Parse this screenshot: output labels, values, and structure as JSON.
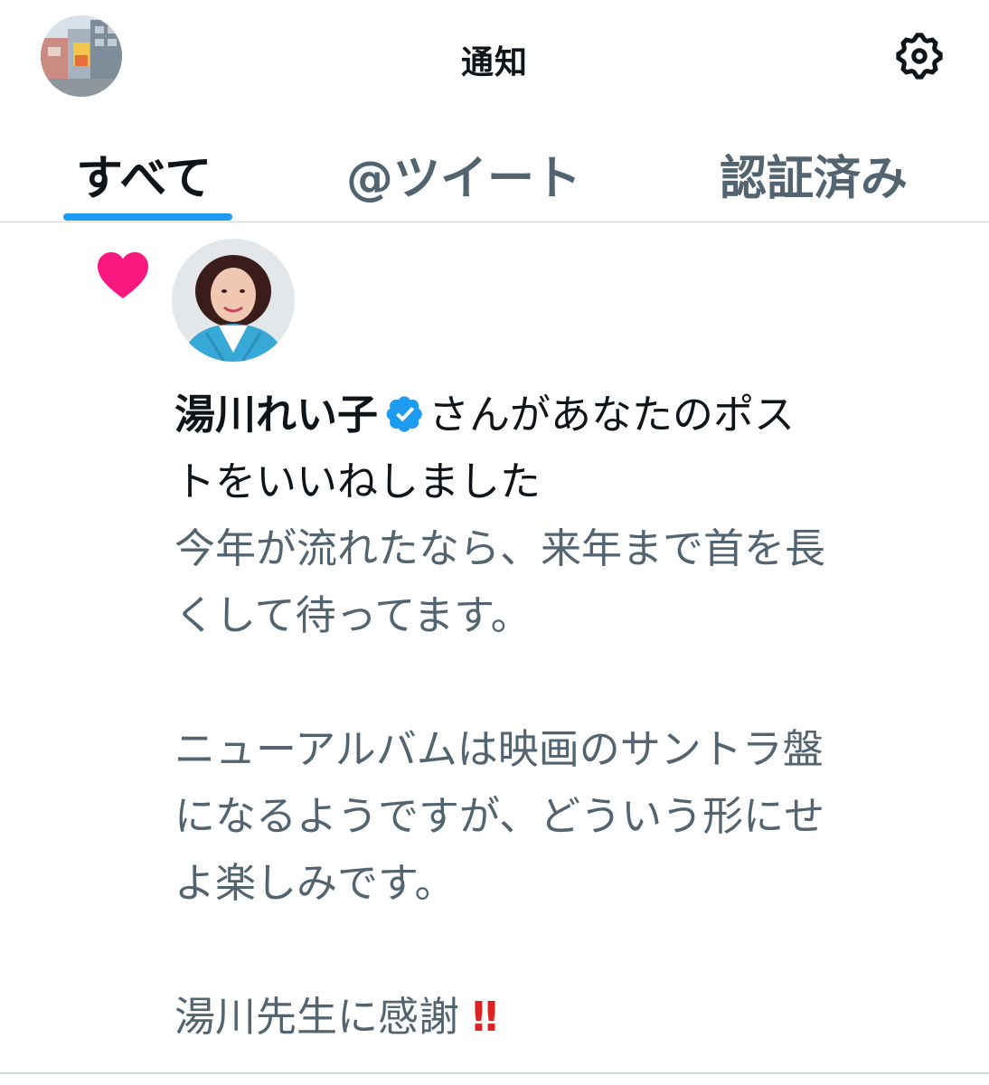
{
  "header": {
    "title": "通知",
    "avatar_icon": "street-photo-avatar-icon",
    "settings_icon": "gear-icon"
  },
  "tabs": [
    {
      "label": "すべて",
      "active": true
    },
    {
      "label": "@ツイート",
      "active": false
    },
    {
      "label": "認証済み",
      "active": false
    }
  ],
  "notification": {
    "type_icon": "heart-icon",
    "type_color": "#f91880",
    "avatar_icon": "user-portrait-avatar-icon",
    "user_name": "湯川れい子",
    "verified_icon": "verified-badge-icon",
    "verified_color": "#1d9bf0",
    "action_text_line1": "さんがあなたのポス",
    "action_text_line2": "トをいいねしました",
    "tweet_text": "今年が流れたなら、来年まで首を長\nくして待ってます。\n\nニューアルバムは映画のサントラ盤\nになるようですが、どういう形にせ\nよ楽しみです。\n\n湯川先生に感謝",
    "tweet_emoji": "‼"
  },
  "colors": {
    "accent": "#1d9bf0",
    "secondary_text": "#536471",
    "primary_text": "#0f1419",
    "like": "#f91880"
  }
}
